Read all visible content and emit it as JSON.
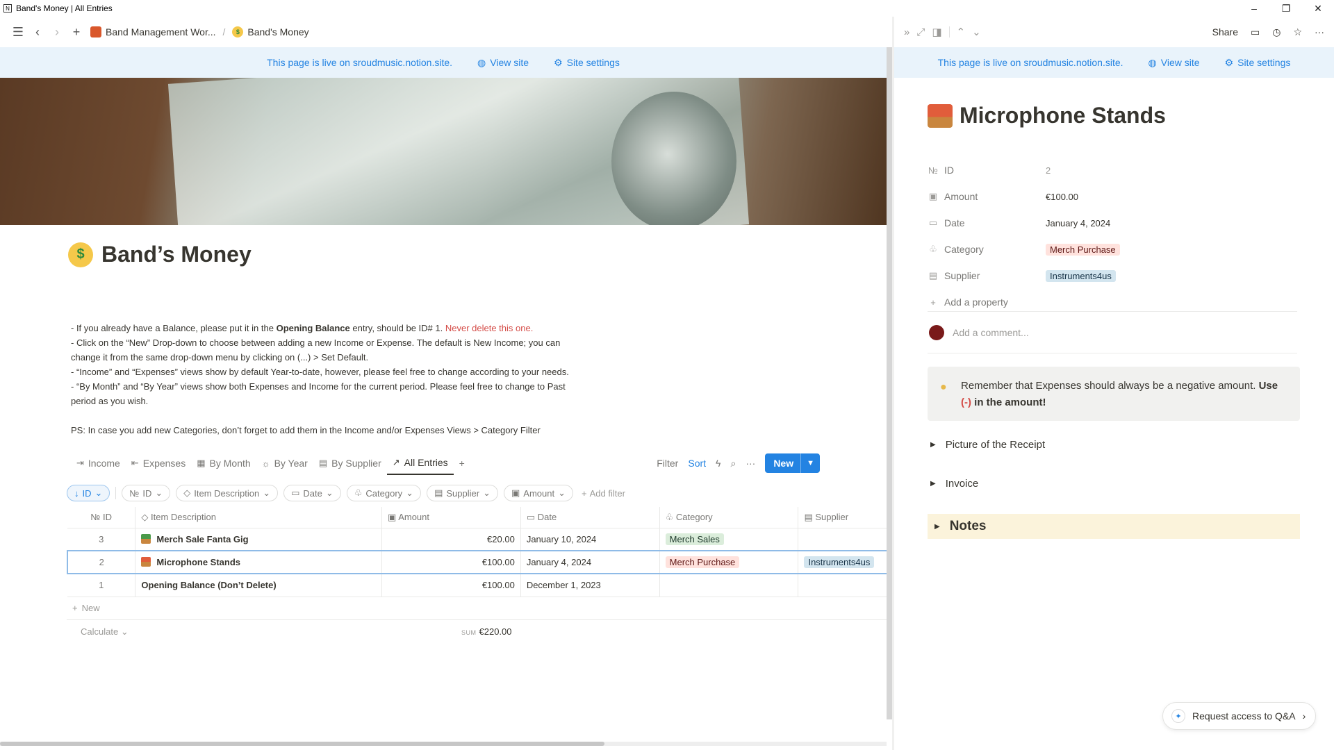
{
  "window": {
    "title": "Band's Money | All Entries",
    "controls": [
      "–",
      "❐",
      "✕"
    ]
  },
  "topbar": {
    "workspace": "Band Management Wor...",
    "separator": "/",
    "page": "Band's Money"
  },
  "banner": {
    "text": "This page is live on sroudmusic.notion.site.",
    "view_site": "View site",
    "site_settings": "Site settings"
  },
  "page": {
    "title": "Band’s Money",
    "emoji": "$",
    "desc": {
      "l1a": "- If you already have a Balance, please put it in the ",
      "l1b": "Opening Balance",
      "l1c": " entry, should be ID# 1. ",
      "l1d": "Never delete this one.",
      "l2": "- Click on the “New” Drop-down to choose between adding a new Income or Expense. The default is New Income; you can",
      "l3": "change it from the same drop-down menu by clicking on (...) > Set Default.",
      "l4": "- “Income” and “Expenses” views show by default Year-to-date, however, please feel free to change according to your needs.",
      "l5": "- “By Month” and “By Year” views show both Expenses and Income for the current period. Please feel free to change to Past",
      "l6": "period as you wish.",
      "l7": "PS: In case you add new Categories, don’t forget to add them in the Income and/or Expenses Views > Category Filter"
    }
  },
  "views": {
    "tabs": [
      "Income",
      "Expenses",
      "By Month",
      "By Year",
      "By Supplier",
      "All Entries"
    ],
    "active": "All Entries",
    "filter": "Filter",
    "sort": "Sort",
    "new": "New"
  },
  "filters": {
    "sort_chip": "ID",
    "chips": [
      "ID",
      "Item Description",
      "Date",
      "Category",
      "Supplier",
      "Amount"
    ],
    "add_filter": "Add filter"
  },
  "table": {
    "headers": [
      "№ ID",
      "Item Description",
      "Amount",
      "Date",
      "Category",
      "Supplier"
    ],
    "rows": [
      {
        "id": "3",
        "item": "Merch Sale Fanta Gig",
        "amount": "€20.00",
        "date": "January 10, 2024",
        "category": "Merch Sales",
        "supplier": ""
      },
      {
        "id": "2",
        "item": "Microphone Stands",
        "amount": "€100.00",
        "date": "January 4, 2024",
        "category": "Merch Purchase",
        "supplier": "Instruments4us"
      },
      {
        "id": "1",
        "item": "Opening Balance (Don’t Delete)",
        "amount": "€100.00",
        "date": "December 1, 2023",
        "category": "",
        "supplier": ""
      }
    ],
    "new_row": "New",
    "calculate": "Calculate",
    "sum_label": "SUM",
    "sum_value": "€220.00"
  },
  "peek": {
    "share": "Share",
    "title": "Microphone Stands",
    "props": {
      "id_label": "ID",
      "id_value": "2",
      "amount_label": "Amount",
      "amount_value": "€100.00",
      "date_label": "Date",
      "date_value": "January 4, 2024",
      "category_label": "Category",
      "category_value": "Merch Purchase",
      "supplier_label": "Supplier",
      "supplier_value": "Instruments4us",
      "add_property": "Add a property"
    },
    "comment_placeholder": "Add a comment...",
    "callout": {
      "a": "Remember that Expenses should always be a negative amount. ",
      "b": "Use",
      "c": "(-)",
      "d": " in the amount!"
    },
    "toggles": [
      "Picture of the Receipt",
      "Invoice"
    ],
    "notes": "Notes",
    "qa": "Request access to Q&A"
  }
}
